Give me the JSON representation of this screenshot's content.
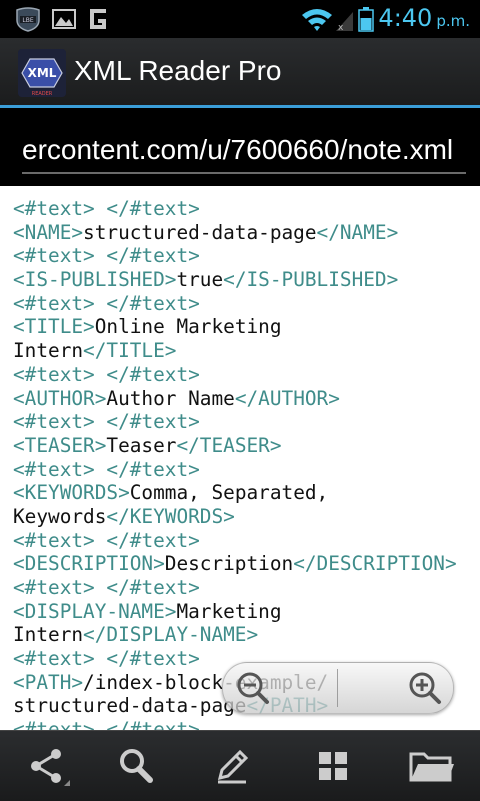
{
  "status_bar": {
    "time": "4:40",
    "ampm": "p.m."
  },
  "app": {
    "logo_text": "XML",
    "logo_subtext": "READER",
    "title": "XML Reader Pro"
  },
  "url_field": {
    "value": "ercontent.com/u/7600660/note.xml"
  },
  "xml_lines": [
    [
      {
        "t": "tag",
        "v": "<#text>"
      },
      {
        "t": "txt",
        "v": " "
      },
      {
        "t": "tag",
        "v": "</#text>"
      }
    ],
    [
      {
        "t": "tag",
        "v": "<NAME>"
      },
      {
        "t": "txt",
        "v": "structured-data-page"
      },
      {
        "t": "tag",
        "v": "</NAME>"
      }
    ],
    [
      {
        "t": "tag",
        "v": "<#text>"
      },
      {
        "t": "txt",
        "v": " "
      },
      {
        "t": "tag",
        "v": "</#text>"
      }
    ],
    [
      {
        "t": "tag",
        "v": "<IS-PUBLISHED>"
      },
      {
        "t": "txt",
        "v": "true"
      },
      {
        "t": "tag",
        "v": "</IS-PUBLISHED>"
      }
    ],
    [
      {
        "t": "tag",
        "v": "<#text>"
      },
      {
        "t": "txt",
        "v": " "
      },
      {
        "t": "tag",
        "v": "</#text>"
      }
    ],
    [
      {
        "t": "tag",
        "v": "<TITLE>"
      },
      {
        "t": "txt",
        "v": "Online Marketing"
      }
    ],
    [
      {
        "t": "txt",
        "v": "Intern"
      },
      {
        "t": "tag",
        "v": "</TITLE>"
      }
    ],
    [
      {
        "t": "tag",
        "v": "<#text>"
      },
      {
        "t": "txt",
        "v": " "
      },
      {
        "t": "tag",
        "v": "</#text>"
      }
    ],
    [
      {
        "t": "tag",
        "v": "<AUTHOR>"
      },
      {
        "t": "txt",
        "v": "Author Name"
      },
      {
        "t": "tag",
        "v": "</AUTHOR>"
      }
    ],
    [
      {
        "t": "tag",
        "v": "<#text>"
      },
      {
        "t": "txt",
        "v": " "
      },
      {
        "t": "tag",
        "v": "</#text>"
      }
    ],
    [
      {
        "t": "tag",
        "v": "<TEASER>"
      },
      {
        "t": "txt",
        "v": "Teaser"
      },
      {
        "t": "tag",
        "v": "</TEASER>"
      }
    ],
    [
      {
        "t": "tag",
        "v": "<#text>"
      },
      {
        "t": "txt",
        "v": " "
      },
      {
        "t": "tag",
        "v": "</#text>"
      }
    ],
    [
      {
        "t": "tag",
        "v": "<KEYWORDS>"
      },
      {
        "t": "txt",
        "v": "Comma, Separated,"
      }
    ],
    [
      {
        "t": "txt",
        "v": "Keywords"
      },
      {
        "t": "tag",
        "v": "</KEYWORDS>"
      }
    ],
    [
      {
        "t": "tag",
        "v": "<#text>"
      },
      {
        "t": "txt",
        "v": " "
      },
      {
        "t": "tag",
        "v": "</#text>"
      }
    ],
    [
      {
        "t": "tag",
        "v": "<DESCRIPTION>"
      },
      {
        "t": "txt",
        "v": "Description"
      },
      {
        "t": "tag",
        "v": "</DESCRIPTION>"
      }
    ],
    [
      {
        "t": "tag",
        "v": "<#text>"
      },
      {
        "t": "txt",
        "v": " "
      },
      {
        "t": "tag",
        "v": "</#text>"
      }
    ],
    [
      {
        "t": "tag",
        "v": "<DISPLAY-NAME>"
      },
      {
        "t": "txt",
        "v": "Marketing"
      }
    ],
    [
      {
        "t": "txt",
        "v": "Intern"
      },
      {
        "t": "tag",
        "v": "</DISPLAY-NAME>"
      }
    ],
    [
      {
        "t": "tag",
        "v": "<#text>"
      },
      {
        "t": "txt",
        "v": " "
      },
      {
        "t": "tag",
        "v": "</#text>"
      }
    ],
    [
      {
        "t": "tag",
        "v": "<PATH>"
      },
      {
        "t": "txt",
        "v": "/index-block-example/"
      }
    ],
    [
      {
        "t": "txt",
        "v": "structured-data-page"
      },
      {
        "t": "tag",
        "v": "</PATH>"
      }
    ],
    [
      {
        "t": "tag",
        "v": "<#text>"
      },
      {
        "t": "txt",
        "v": " "
      },
      {
        "t": "tag",
        "v": "</#text>"
      }
    ]
  ],
  "colors": {
    "accent": "#3b9ed9",
    "status_icon": "#4cc7f0",
    "xml_tag": "#3f8c8a",
    "xml_text": "#111111"
  },
  "icons": {
    "status_left": [
      "lbe-badge-icon",
      "gallery-icon",
      "g-app-icon"
    ],
    "status_right": [
      "wifi-icon",
      "signal-icon",
      "battery-icon"
    ],
    "zoom": [
      "zoom-out-icon",
      "zoom-in-icon"
    ],
    "bottom_bar": [
      "share-icon",
      "search-icon",
      "edit-icon",
      "grid-icon",
      "folder-icon"
    ]
  }
}
